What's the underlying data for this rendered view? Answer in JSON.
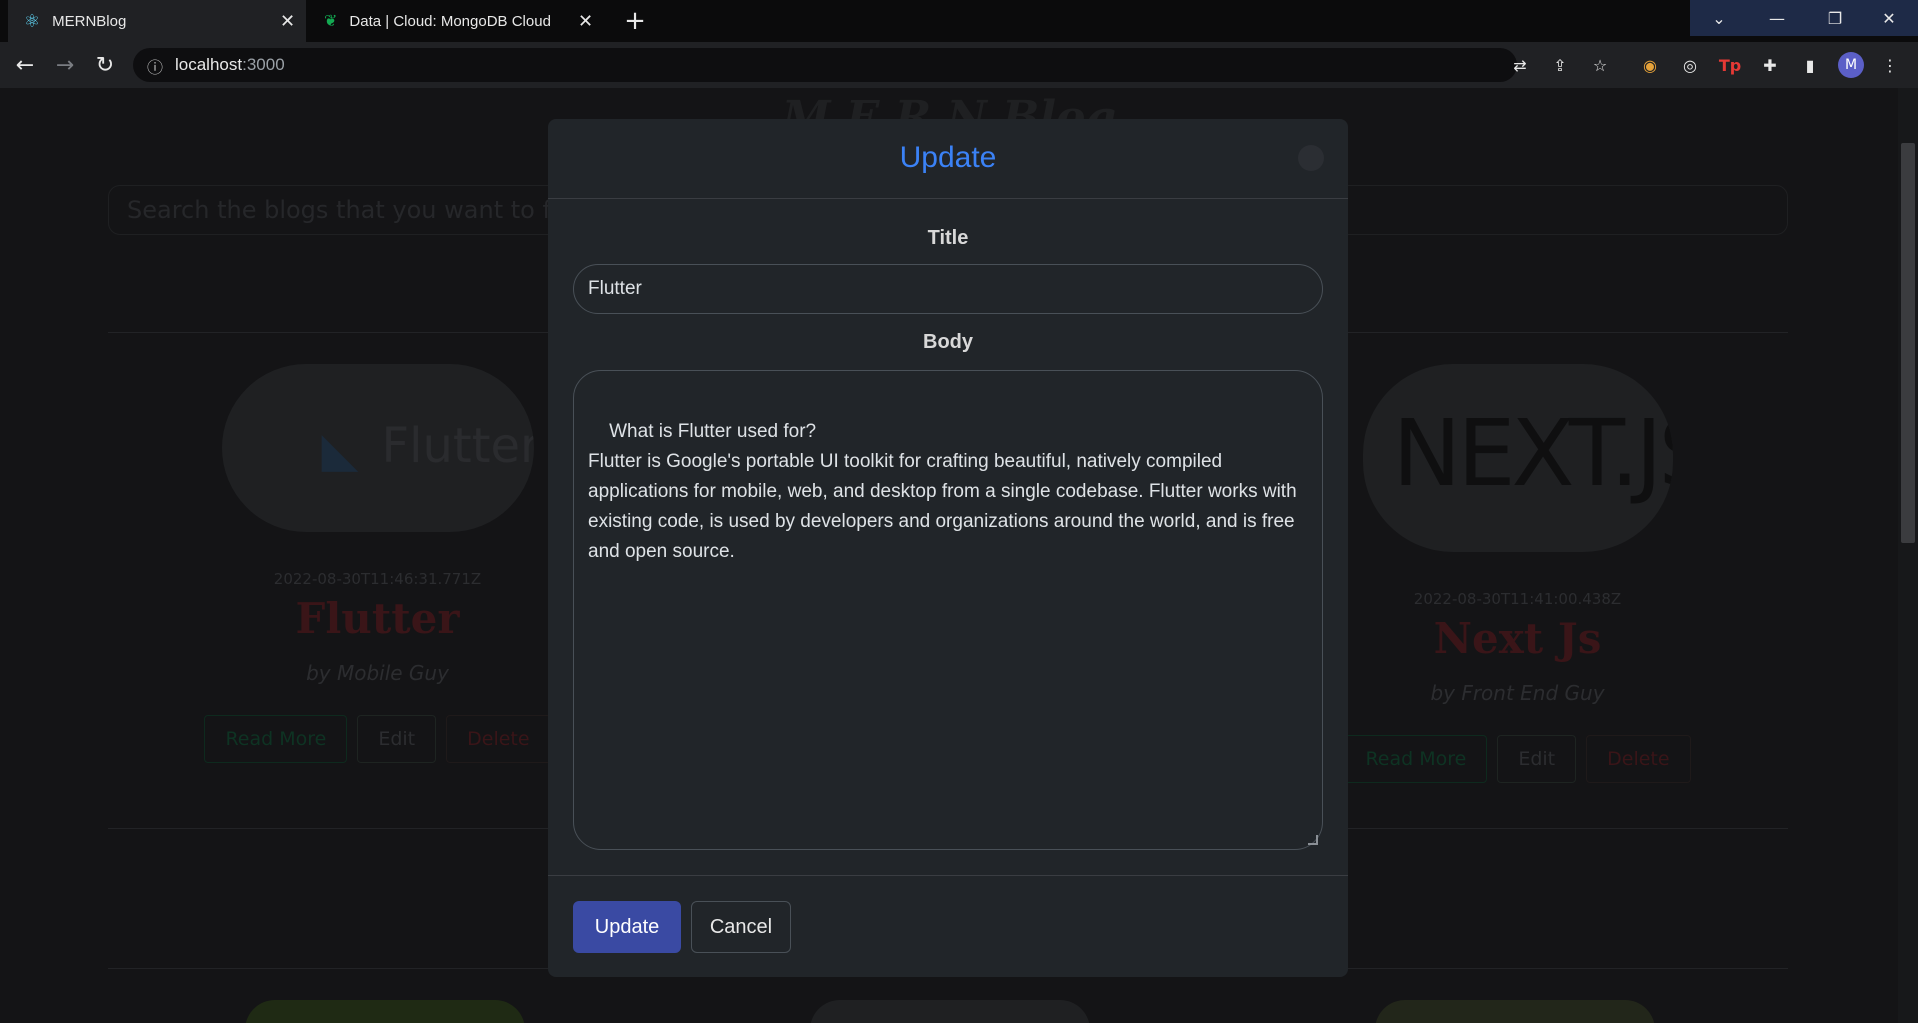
{
  "browser": {
    "tabs": [
      {
        "title": "MERNBlog",
        "icon": "react-icon"
      },
      {
        "title": "Data | Cloud: MongoDB Cloud",
        "icon": "mongodb-leaf-icon"
      }
    ],
    "url_host": "localhost",
    "url_port": ":3000",
    "profile_initial": "M"
  },
  "page": {
    "title": "M E R N Blog",
    "search_placeholder": "Search the blogs that you want to find",
    "cards": [
      {
        "image_text": "Flutter",
        "date": "2022-08-30T11:46:31.771Z",
        "title": "Flutter",
        "author": "by Mobile Guy",
        "read_label": "Read More",
        "edit_label": "Edit",
        "delete_label": "Delete"
      },
      {
        "image_text": "NEXT.JS",
        "date": "2022-08-30T11:41:00.438Z",
        "title": "Next Js",
        "author": "by Front End Guy",
        "read_label": "Read More",
        "edit_label": "Edit",
        "delete_label": "Delete"
      }
    ]
  },
  "modal": {
    "title": "Update",
    "title_label": "Title",
    "title_value": "Flutter",
    "body_label": "Body",
    "body_value": "What is Flutter used for?\nFlutter is Google's portable UI toolkit for crafting beautiful, natively compiled applications for mobile, web, and desktop from a single codebase. Flutter works with existing code, is used by developers and organizations around the world, and is free and open source.",
    "update_label": "Update",
    "cancel_label": "Cancel"
  },
  "colors": {
    "accent": "#3b82f6",
    "update_button": "#3a4aa3"
  }
}
